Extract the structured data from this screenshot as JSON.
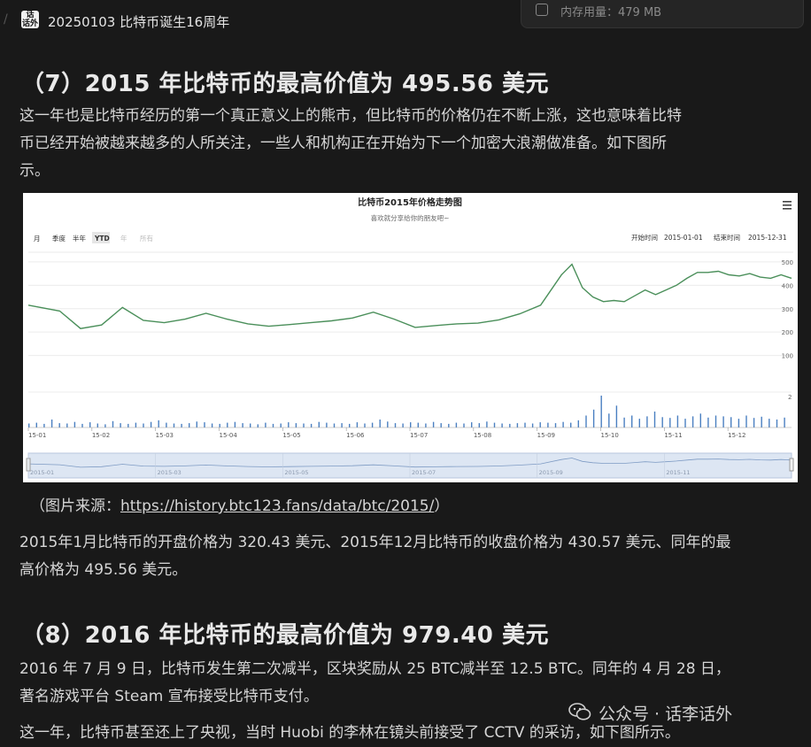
{
  "header": {
    "tab_title": "20250103 比特币诞生16周年",
    "app_icon_text": [
      "话",
      "李",
      "话外"
    ],
    "memory_label": "内存用量：479 MB"
  },
  "section7": {
    "heading": "（7）2015 年比特币的最高价值为 495.56 美元",
    "para_lines": [
      "这一年也是比特币经历的第一个真正意义上的熊市，但比特币的价格仍在不断上涨，这也意味着比特",
      "币已经开始被越来越多的人所关注，一些人和机构正在开始为下一个加密大浪潮做准备。如下图所",
      "示。"
    ],
    "source_prefix": "（图片来源：",
    "source_link": "https://history.btc123.fans/data/btc/2015/",
    "source_suffix": "）",
    "summary_lines": [
      "2015年1月比特币的开盘价格为 320.43 美元、2015年12月比特币的收盘价格为 430.57 美元、同年的最",
      "高价格为 495.56 美元。"
    ]
  },
  "section8": {
    "heading": "（8）2016 年比特币的最高价值为 979.40 美元",
    "para_lines": [
      "2016 年 7 月 9 日，比特币发生第二次减半，区块奖励从 25 BTC减半至 12.5 BTC。同年的 4 月 28 日，",
      "著名游戏平台 Steam 宣布接受比特币支付。"
    ],
    "para2": "这一年，比特币甚至还上了央视，当时 Huobi 的李林在镜头前接受了 CCTV 的采访，如下图所示。"
  },
  "watermark": {
    "text": "公众号 · 话李话外"
  },
  "chart_data": {
    "type": "line",
    "title": "比特币2015年价格走势图",
    "subtitle": "喜欢就分享给你的朋友吧~",
    "range_buttons": [
      "月",
      "季度",
      "半年",
      "YTD",
      "年",
      "所有"
    ],
    "selected_range": "YTD",
    "start_label": "开始时间",
    "start_value": "2015-01-01",
    "end_label": "结束时间",
    "end_value": "2015-12-31",
    "menu_icon": "hamburger-icon",
    "y_ticks": [
      100,
      200,
      300,
      400,
      500
    ],
    "ylim": [
      0,
      530
    ],
    "volume_tick": "2",
    "x_ticks": [
      "15-01",
      "15-02",
      "15-03",
      "15-04",
      "15-05",
      "15-06",
      "15-07",
      "15-08",
      "15-09",
      "15-10",
      "15-11",
      "15-12"
    ],
    "navigator_labels": [
      "2015-01",
      "2015-03",
      "2015-05",
      "2015-07",
      "2015-09",
      "2015-11"
    ],
    "x": [
      0,
      3,
      5,
      7,
      9,
      11,
      13,
      15,
      17,
      19,
      21,
      23,
      25,
      27,
      29,
      31,
      33,
      35,
      37,
      39,
      41,
      43,
      45,
      47,
      49,
      51
    ],
    "series": [
      {
        "color": "#4a8f5a",
        "values": [
          315,
          290,
          215,
          230,
          305,
          250,
          240,
          255,
          280,
          255,
          235,
          225,
          232,
          240,
          248,
          260,
          285,
          255,
          220,
          228,
          235,
          238,
          252,
          278,
          315,
          445
        ]
      }
    ],
    "series_b": {
      "x": [
        51,
        52,
        53,
        54,
        55,
        56,
        57,
        58,
        59,
        60,
        61,
        62,
        63,
        64,
        65,
        66,
        67,
        68,
        69,
        70,
        71,
        72,
        73
      ],
      "values": [
        445,
        490,
        390,
        350,
        330,
        335,
        330,
        355,
        380,
        360,
        380,
        400,
        430,
        455,
        455,
        460,
        445,
        440,
        450,
        435,
        430,
        445,
        430
      ]
    },
    "volume": [
      0.1,
      0.12,
      0.09,
      0.2,
      0.11,
      0.1,
      0.14,
      0.09,
      0.13,
      0.1,
      0.08,
      0.16,
      0.11,
      0.09,
      0.12,
      0.1,
      0.14,
      0.18,
      0.12,
      0.1,
      0.09,
      0.11,
      0.15,
      0.13,
      0.1,
      0.09,
      0.12,
      0.14,
      0.11,
      0.1,
      0.08,
      0.12,
      0.09,
      0.1,
      0.13,
      0.11,
      0.1,
      0.09,
      0.14,
      0.12,
      0.1,
      0.11,
      0.09,
      0.13,
      0.1,
      0.12,
      0.2,
      0.15,
      0.11,
      0.1,
      0.13,
      0.12,
      0.1,
      0.14,
      0.11,
      0.09,
      0.12,
      0.1,
      0.13,
      0.11,
      0.15,
      0.12,
      0.1,
      0.09,
      0.11,
      0.12,
      0.1,
      0.13,
      0.12,
      0.11,
      0.14,
      0.12,
      0.18,
      0.3,
      0.45,
      0.8,
      0.35,
      0.55,
      0.25,
      0.3,
      0.22,
      0.28,
      0.4,
      0.26,
      0.24,
      0.3,
      0.22,
      0.28,
      0.35,
      0.25,
      0.3,
      0.28,
      0.26,
      0.22,
      0.3,
      0.24,
      0.27,
      0.22,
      0.2,
      0.25
    ]
  }
}
